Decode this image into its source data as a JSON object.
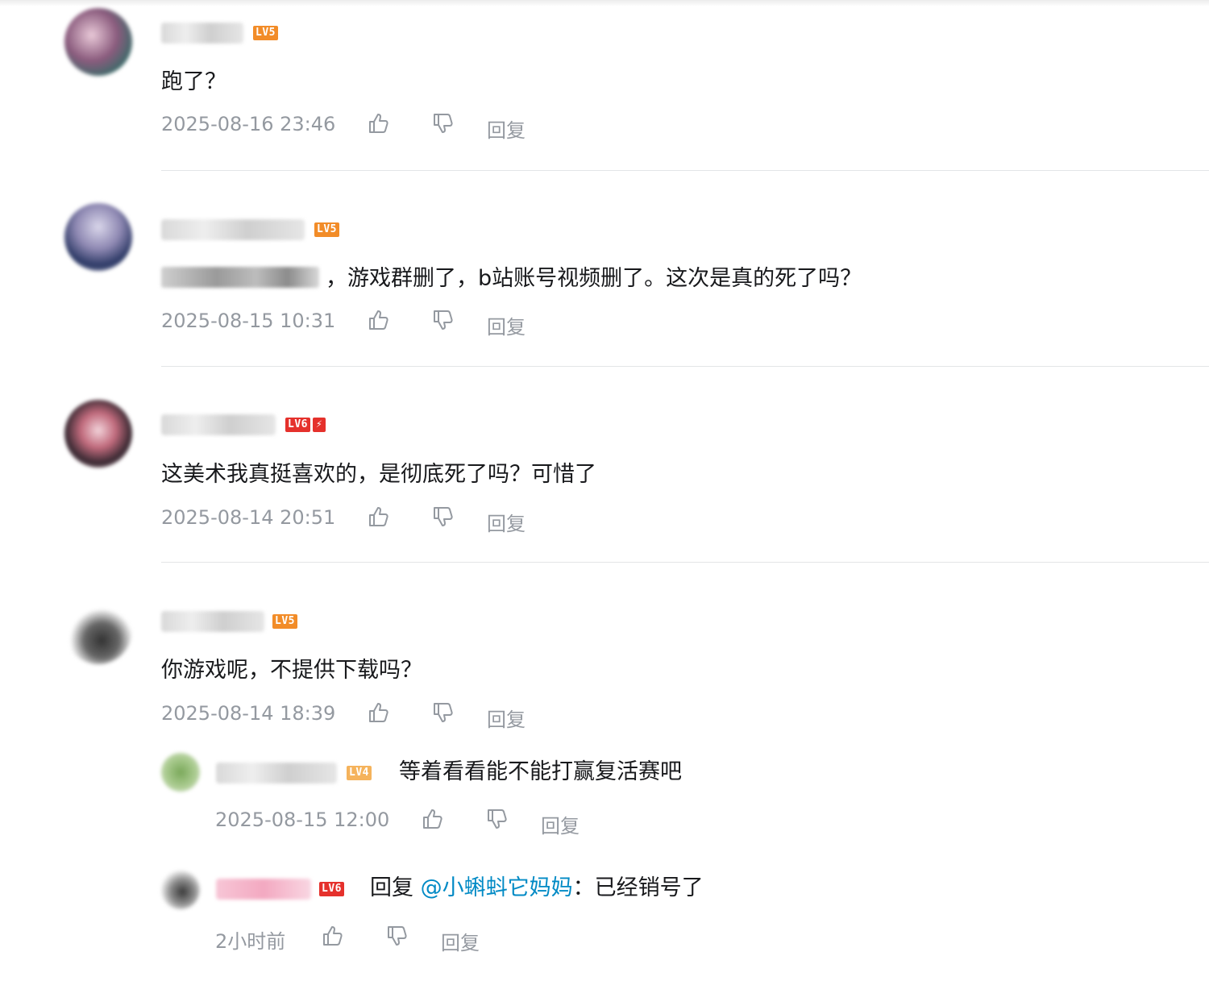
{
  "colors": {
    "lv5": "#f28c28",
    "lv6": "#e5312c",
    "lv4": "#f5b35c",
    "mention": "#008ac5",
    "meta_text": "#9499a0"
  },
  "icons": {
    "like": "thumbs-up-icon",
    "dislike": "thumbs-down-icon"
  },
  "comments": [
    {
      "level_badge": "LV5",
      "content": "跑了？",
      "time": "2025-08-16 23:46",
      "reply_label": "回复"
    },
    {
      "level_badge": "LV5",
      "content": "，游戏群删了，b站账号视频删了。这次是真的死了吗？",
      "time": "2025-08-15 10:31",
      "reply_label": "回复"
    },
    {
      "level_badge": "LV6",
      "content": "这美术我真挺喜欢的，是彻底死了吗？可惜了",
      "time": "2025-08-14 20:51",
      "reply_label": "回复"
    },
    {
      "level_badge": "LV5",
      "content": "你游戏呢，不提供下载吗？",
      "time": "2025-08-14 18:39",
      "reply_label": "回复",
      "sub_replies": [
        {
          "level_badge": "LV4",
          "content": "等着看看能不能打赢复活赛吧",
          "time": "2025-08-15 12:00",
          "reply_label": "回复"
        },
        {
          "level_badge": "LV6",
          "reply_prefix": "回复",
          "mention": "@小蝌蚪它妈妈",
          "content": "：已经销号了",
          "time": "2小时前",
          "reply_label": "回复"
        }
      ]
    }
  ]
}
